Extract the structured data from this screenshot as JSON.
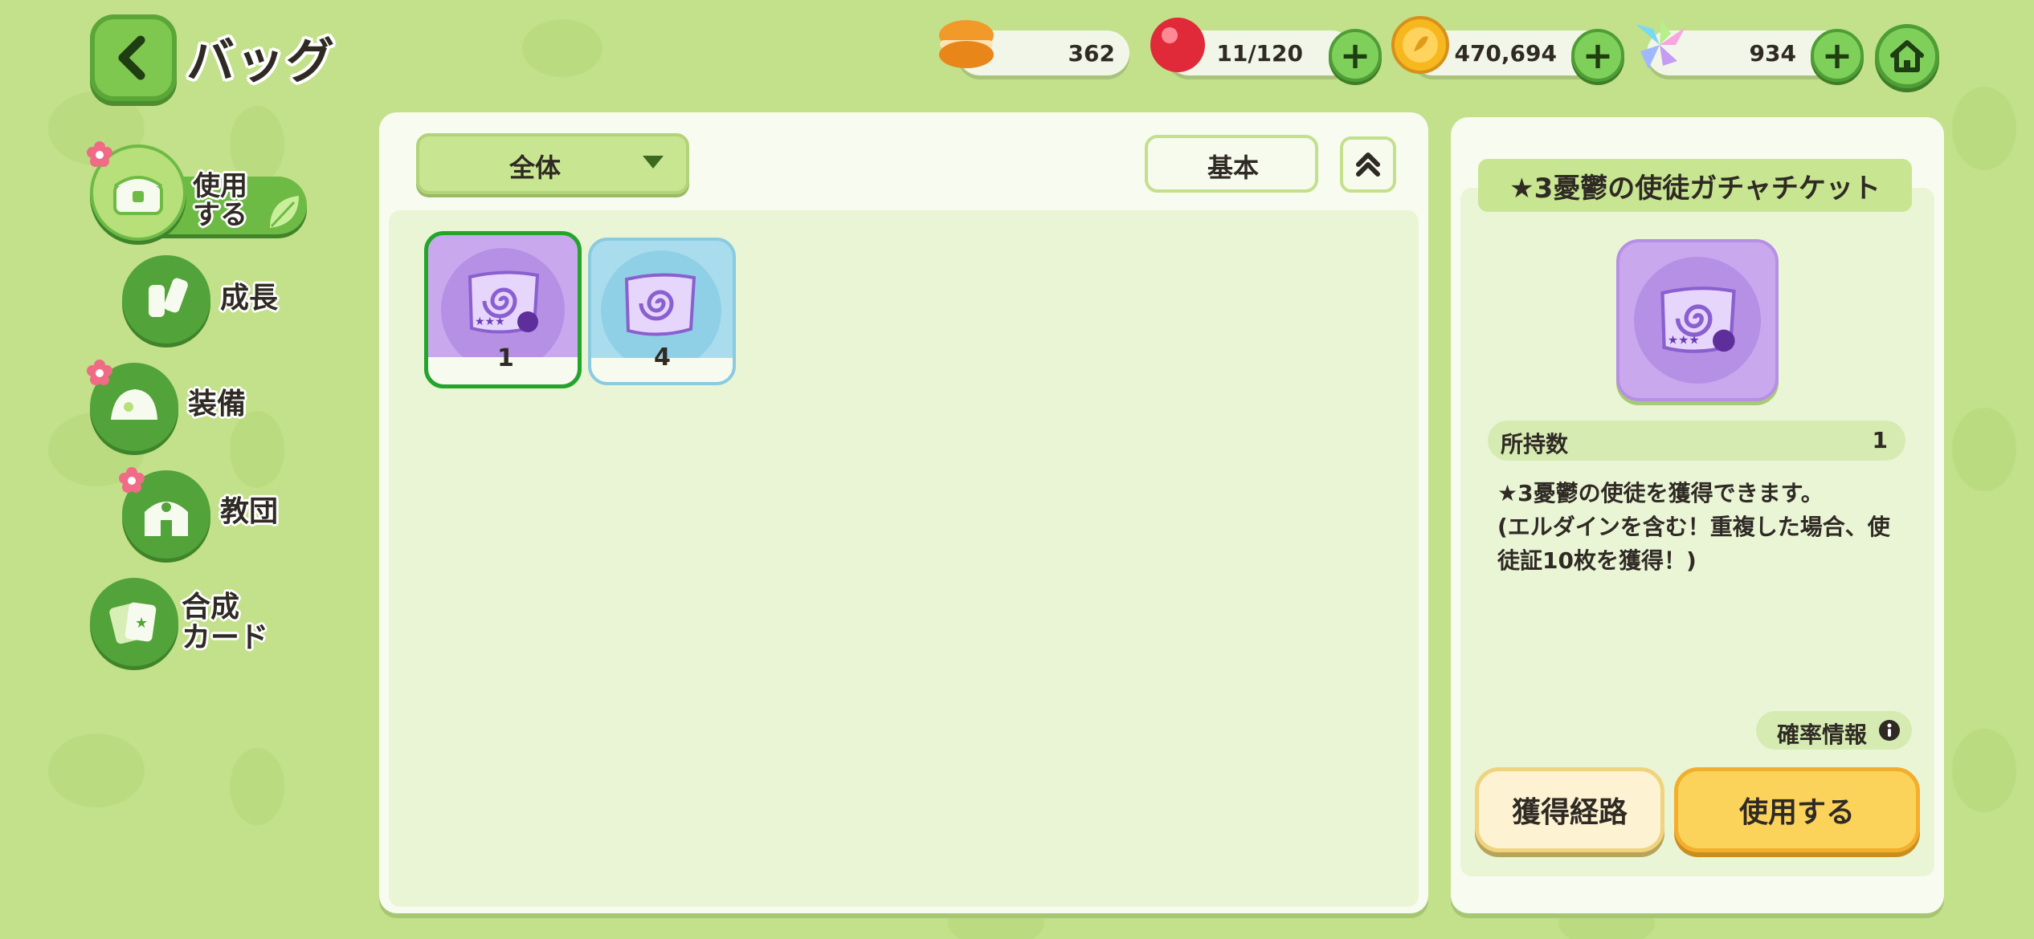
{
  "header": {
    "title": "バッグ"
  },
  "resources": [
    {
      "icon": "macaron-icon",
      "value": "362",
      "has_plus": false
    },
    {
      "icon": "red-candy-icon",
      "value": "11/120",
      "has_plus": true
    },
    {
      "icon": "gold-coin-icon",
      "value": "470,694",
      "has_plus": true
    },
    {
      "icon": "rainbow-crystal-icon",
      "value": "934",
      "has_plus": true
    }
  ],
  "sidebar": {
    "items": [
      {
        "label": "使用する",
        "icon": "chest-icon",
        "selected": true,
        "badge": true
      },
      {
        "label": "成長",
        "icon": "potion-icon",
        "selected": false,
        "badge": false
      },
      {
        "label": "装備",
        "icon": "hat-icon",
        "selected": false,
        "badge": true
      },
      {
        "label": "教団",
        "icon": "building-icon",
        "selected": false,
        "badge": true
      },
      {
        "label": "合成カード",
        "icon": "cards-icon",
        "selected": false,
        "badge": false
      }
    ]
  },
  "filter": {
    "category": "全体",
    "sort": "基本"
  },
  "inventory": [
    {
      "icon": "purple-gacha-ticket-icon",
      "count": "1",
      "selected": true,
      "rarity_color": "#c9a8ee"
    },
    {
      "icon": "blue-gacha-ticket-icon",
      "count": "4",
      "selected": false,
      "rarity_color": "#a9ddee"
    }
  ],
  "detail": {
    "name": "★3憂鬱の使徒ガチャチケット",
    "owned_label": "所持数",
    "owned_value": "1",
    "description_line1": "★3憂鬱の使徒を獲得できます。",
    "description_line2": "(エルダインを含む！重複した場合、使",
    "description_line3": "徒証10枚を獲得！)",
    "probability_label": "確率情報",
    "source_button": "獲得経路",
    "use_button": "使用する"
  },
  "colors": {
    "background": "#c3e08a",
    "accent_green": "#52a33a",
    "selected_border": "#22a52a",
    "use_button": "#fcd35a"
  }
}
